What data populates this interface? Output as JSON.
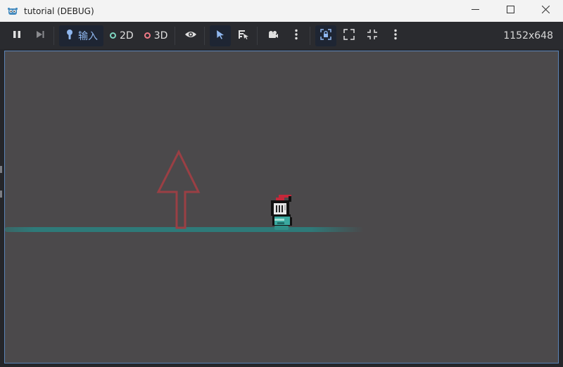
{
  "window": {
    "title": "tutorial (DEBUG)",
    "controls": [
      "minimize",
      "maximize",
      "close"
    ]
  },
  "toolbar": {
    "input_label": "输入",
    "mode_2d_label": "2D",
    "mode_3d_label": "3D",
    "resolution": "1152x648"
  },
  "colors": {
    "accent": "#8fb7ef",
    "viewport_bg": "#4b494b",
    "ground": "#2e7a79",
    "arrow": "#9a3f44",
    "ring_2d": "#7fd6c0",
    "ring_3d": "#f07a86"
  },
  "icons": [
    "godot-icon",
    "pause-icon",
    "next-frame-icon",
    "input-icon",
    "eye-icon",
    "select-arrow-icon",
    "list-select-icon",
    "camera-icon",
    "more-vertical-icon",
    "lock-camera-icon",
    "expand-icon",
    "shrink-icon"
  ]
}
